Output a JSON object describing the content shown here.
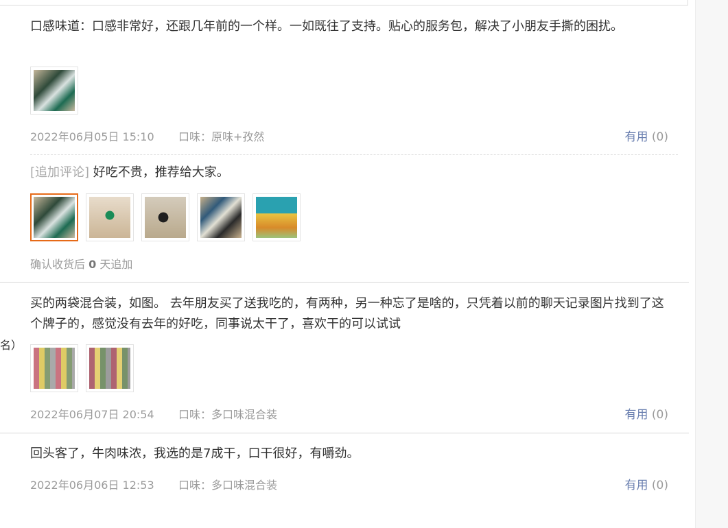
{
  "reviews": [
    {
      "text": "口感味道：口感非常好，还跟几年前的一个样。一如既往了支持。贴心的服务包，解决了小朋友手撕的困扰。",
      "date": "2022年06月05日 15:10",
      "flavor": "口味：原味+孜然",
      "useful_label": "有用",
      "useful_count": "(0)",
      "addon": {
        "tag": "[追加评论]",
        "text": "好吃不贵，推荐给大家。",
        "note_prefix": "确认收货后",
        "note_days": "0",
        "note_suffix": "天追加"
      }
    },
    {
      "text": "买的两袋混合装，如图。 去年朋友买了送我吃的，有两种，另一种忘了是啥的，只凭着以前的聊天记录图片找到了这个牌子的，感觉没有去年的好吃，同事说太干了，喜欢干的可以试试",
      "date": "2022年06月07日 20:54",
      "flavor": "口味：多口味混合装",
      "useful_label": "有用",
      "useful_count": "(0)"
    },
    {
      "text": "回头客了，牛肉味浓，我选的是7成干，口干很好，有嚼劲。",
      "date": "2022年06月06日 12:53",
      "flavor": "口味：多口味混合装",
      "useful_label": "有用",
      "useful_count": "(0)"
    }
  ],
  "left_fragment": "名）",
  "accent_color": "#e66a17",
  "link_color": "#6a7fb0"
}
